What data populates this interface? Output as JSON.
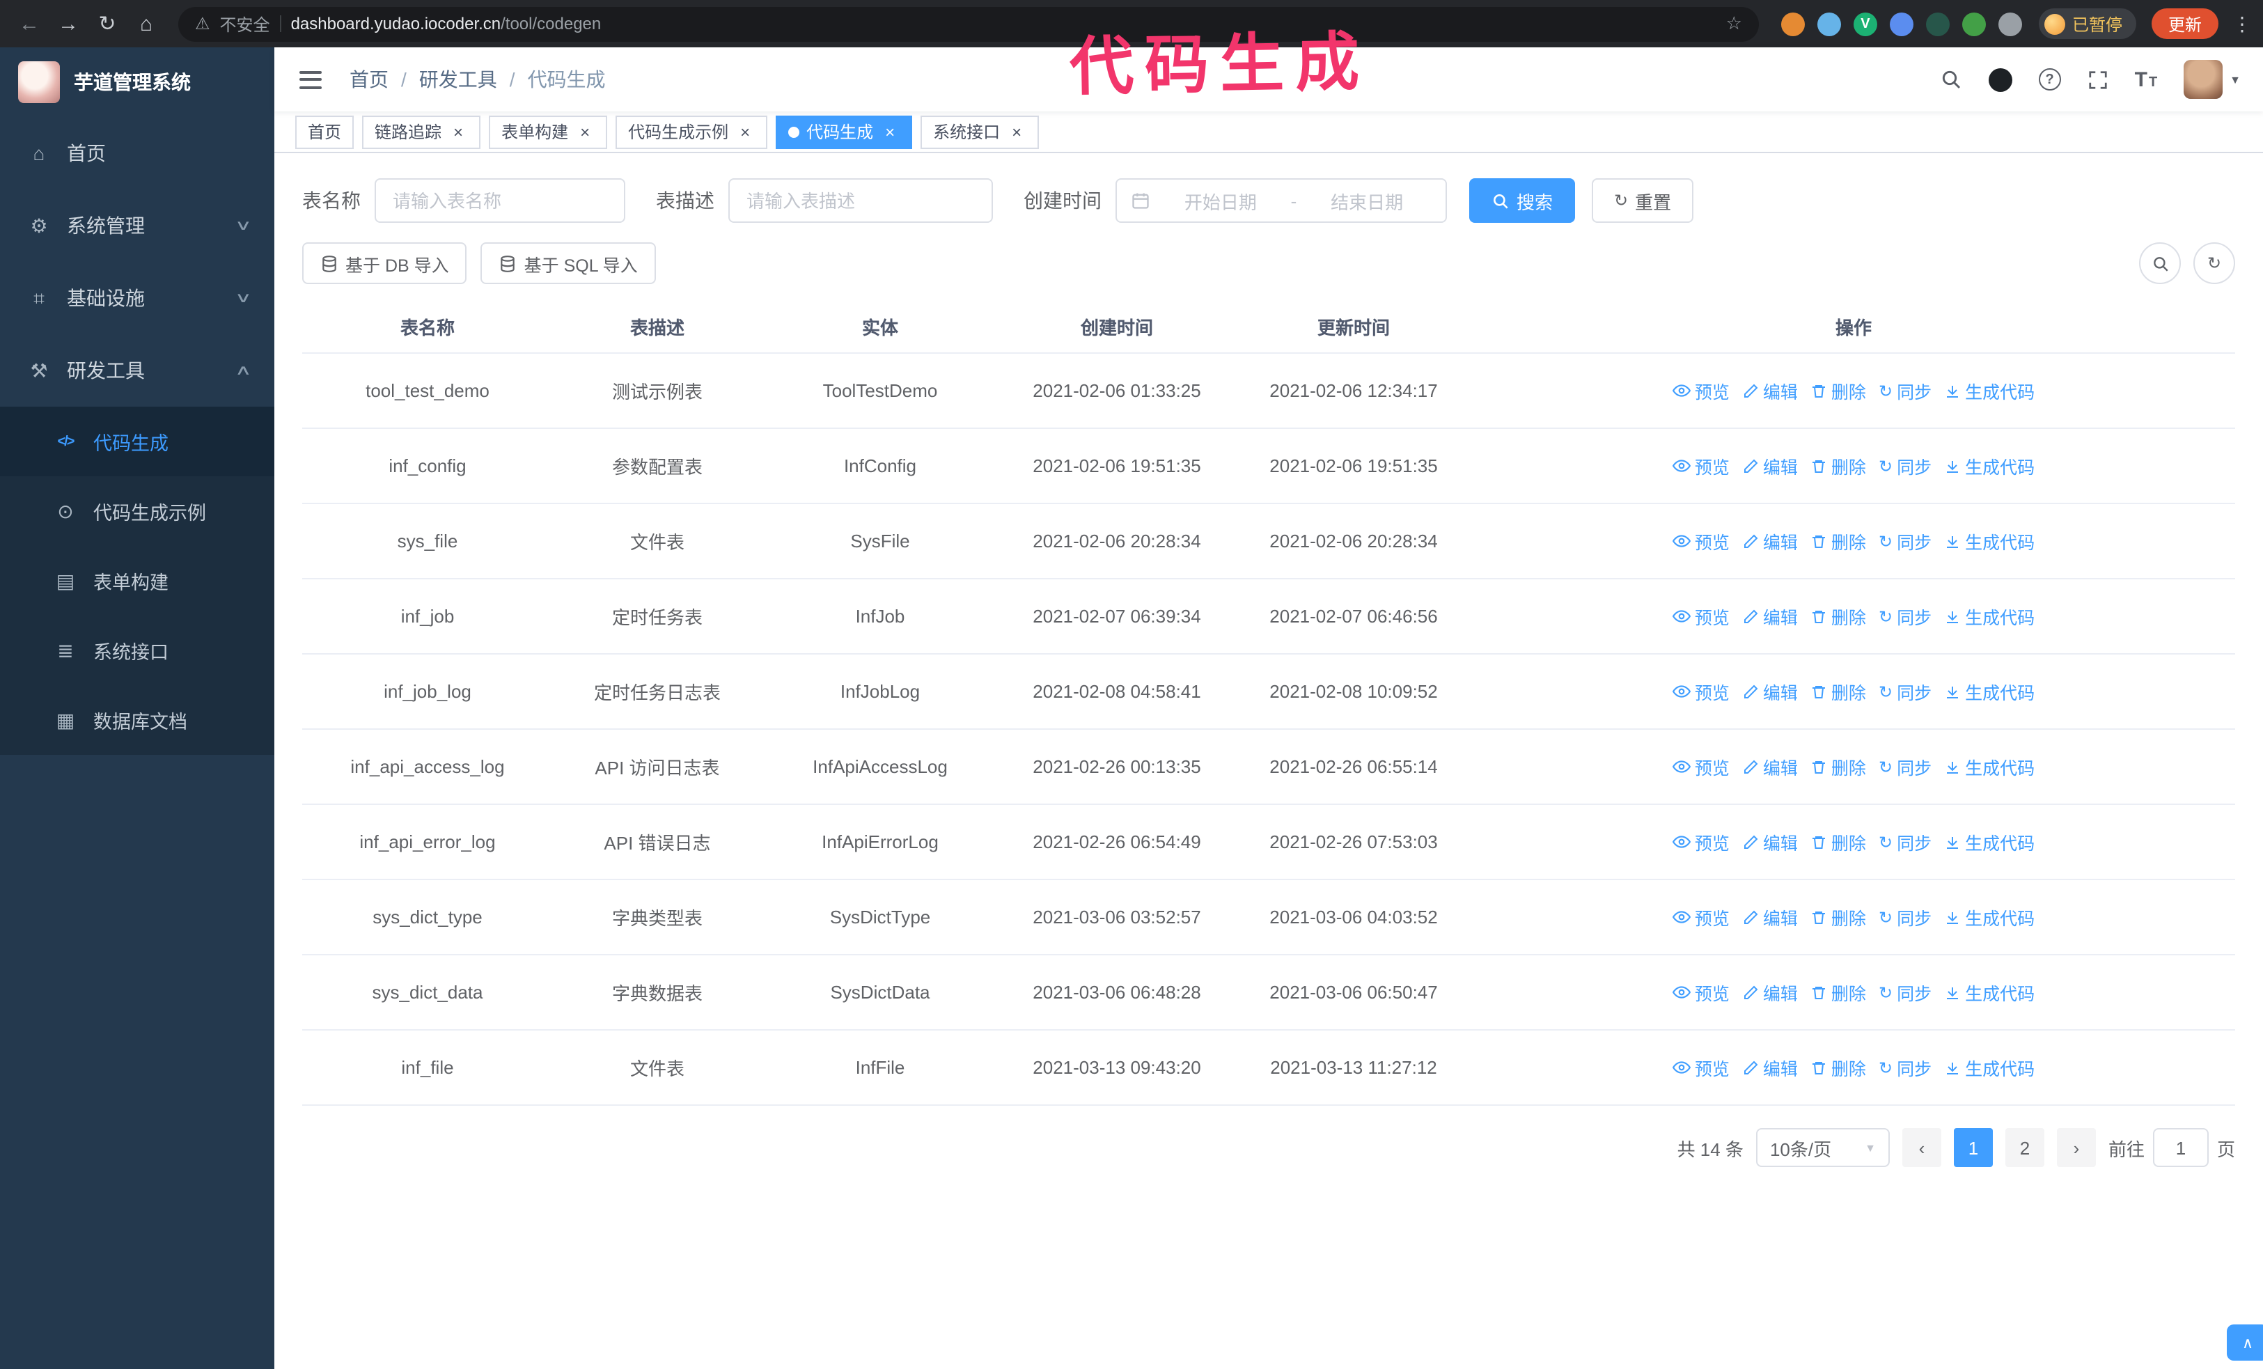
{
  "colors": {
    "primary": "#409eff",
    "annotation_pink": "#f2356b",
    "sidebar_bg": "#24394e",
    "update_button": "#e0502f"
  },
  "annotation": {
    "text": "代码生成"
  },
  "browser": {
    "security_label": "不安全",
    "url_host": "dashboard.yudao.iocoder.cn",
    "url_path": "/tool/codegen",
    "paused_badge": "已暂停",
    "update_button": "更新",
    "extensions": [
      {
        "name": "extension-orange-icon",
        "color": "#e58a33"
      },
      {
        "name": "extension-blue-icon",
        "color": "#66b3e8"
      },
      {
        "name": "extension-vue-devtools-icon",
        "color": "#1cb173",
        "glyph": "V"
      },
      {
        "name": "extension-people-icon",
        "color": "#5b8def"
      },
      {
        "name": "extension-dark-icon",
        "color": "#27564a"
      },
      {
        "name": "extension-green-icon",
        "color": "#43a047"
      },
      {
        "name": "extension-puzzle-icon",
        "color": "#9aa0a6"
      }
    ]
  },
  "sidebar": {
    "logo_title": "芋道管理系统",
    "menu": [
      {
        "label": "首页",
        "icon": "home-icon"
      },
      {
        "label": "系统管理",
        "icon": "gear-icon",
        "chevron": "down"
      },
      {
        "label": "基础设施",
        "icon": "monitor-icon",
        "chevron": "down"
      },
      {
        "label": "研发工具",
        "icon": "tools-icon",
        "chevron": "up"
      }
    ],
    "submenu": [
      {
        "label": "代码生成",
        "icon": "code-icon",
        "active": true
      },
      {
        "label": "代码生成示例",
        "icon": "example-icon"
      },
      {
        "label": "表单构建",
        "icon": "form-icon"
      },
      {
        "label": "系统接口",
        "icon": "api-icon"
      },
      {
        "label": "数据库文档",
        "icon": "database-icon"
      }
    ]
  },
  "header": {
    "breadcrumb": [
      "首页",
      "研发工具",
      "代码生成"
    ],
    "separator": "/"
  },
  "tabs": [
    {
      "label": "首页",
      "closable": false
    },
    {
      "label": "链路追踪",
      "closable": true
    },
    {
      "label": "表单构建",
      "closable": true
    },
    {
      "label": "代码生成示例",
      "closable": true
    },
    {
      "label": "代码生成",
      "closable": true,
      "active": true
    },
    {
      "label": "系统接口",
      "closable": true
    }
  ],
  "filters": {
    "table_name_label": "表名称",
    "table_name_placeholder": "请输入表名称",
    "table_desc_label": "表描述",
    "table_desc_placeholder": "请输入表描述",
    "create_time_label": "创建时间",
    "date_start_placeholder": "开始日期",
    "date_separator": "-",
    "date_end_placeholder": "结束日期",
    "search_button": "搜索",
    "reset_button": "重置"
  },
  "toolbar": {
    "import_db_label": "基于 DB 导入",
    "import_sql_label": "基于 SQL 导入"
  },
  "table": {
    "columns": [
      "表名称",
      "表描述",
      "实体",
      "创建时间",
      "更新时间",
      "操作"
    ],
    "actions": [
      "预览",
      "编辑",
      "删除",
      "同步",
      "生成代码"
    ],
    "rows": [
      {
        "name": "tool_test_demo",
        "desc": "测试示例表",
        "entity": "ToolTestDemo",
        "create_time": "2021-02-06 01:33:25",
        "update_time": "2021-02-06 12:34:17"
      },
      {
        "name": "inf_config",
        "desc": "参数配置表",
        "entity": "InfConfig",
        "create_time": "2021-02-06 19:51:35",
        "update_time": "2021-02-06 19:51:35"
      },
      {
        "name": "sys_file",
        "desc": "文件表",
        "entity": "SysFile",
        "create_time": "2021-02-06 20:28:34",
        "update_time": "2021-02-06 20:28:34"
      },
      {
        "name": "inf_job",
        "desc": "定时任务表",
        "entity": "InfJob",
        "create_time": "2021-02-07 06:39:34",
        "update_time": "2021-02-07 06:46:56"
      },
      {
        "name": "inf_job_log",
        "desc": "定时任务日志表",
        "entity": "InfJobLog",
        "create_time": "2021-02-08 04:58:41",
        "update_time": "2021-02-08 10:09:52"
      },
      {
        "name": "inf_api_access_log",
        "desc": "API 访问日志表",
        "entity": "InfApiAccessLog",
        "create_time": "2021-02-26 00:13:35",
        "update_time": "2021-02-26 06:55:14"
      },
      {
        "name": "inf_api_error_log",
        "desc": "API 错误日志",
        "entity": "InfApiErrorLog",
        "create_time": "2021-02-26 06:54:49",
        "update_time": "2021-02-26 07:53:03"
      },
      {
        "name": "sys_dict_type",
        "desc": "字典类型表",
        "entity": "SysDictType",
        "create_time": "2021-03-06 03:52:57",
        "update_time": "2021-03-06 04:03:52"
      },
      {
        "name": "sys_dict_data",
        "desc": "字典数据表",
        "entity": "SysDictData",
        "create_time": "2021-03-06 06:48:28",
        "update_time": "2021-03-06 06:50:47"
      },
      {
        "name": "inf_file",
        "desc": "文件表",
        "entity": "InfFile",
        "create_time": "2021-03-13 09:43:20",
        "update_time": "2021-03-13 11:27:12"
      }
    ]
  },
  "pagination": {
    "total_text": "共 14 条",
    "page_size": "10条/页",
    "pages": [
      "1",
      "2"
    ],
    "active_page": "1",
    "goto_label": "前往",
    "goto_value": "1",
    "goto_unit": "页"
  }
}
